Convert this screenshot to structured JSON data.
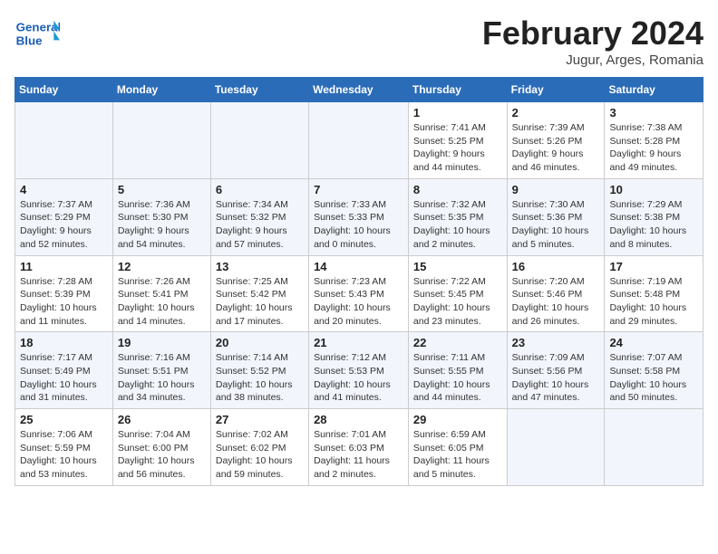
{
  "header": {
    "title": "February 2024",
    "subtitle": "Jugur, Arges, Romania",
    "logo_text_general": "General",
    "logo_text_blue": "Blue"
  },
  "days_of_week": [
    "Sunday",
    "Monday",
    "Tuesday",
    "Wednesday",
    "Thursday",
    "Friday",
    "Saturday"
  ],
  "weeks": [
    [
      {
        "day": "",
        "info": ""
      },
      {
        "day": "",
        "info": ""
      },
      {
        "day": "",
        "info": ""
      },
      {
        "day": "",
        "info": ""
      },
      {
        "day": "1",
        "info": "Sunrise: 7:41 AM\nSunset: 5:25 PM\nDaylight: 9 hours\nand 44 minutes."
      },
      {
        "day": "2",
        "info": "Sunrise: 7:39 AM\nSunset: 5:26 PM\nDaylight: 9 hours\nand 46 minutes."
      },
      {
        "day": "3",
        "info": "Sunrise: 7:38 AM\nSunset: 5:28 PM\nDaylight: 9 hours\nand 49 minutes."
      }
    ],
    [
      {
        "day": "4",
        "info": "Sunrise: 7:37 AM\nSunset: 5:29 PM\nDaylight: 9 hours\nand 52 minutes."
      },
      {
        "day": "5",
        "info": "Sunrise: 7:36 AM\nSunset: 5:30 PM\nDaylight: 9 hours\nand 54 minutes."
      },
      {
        "day": "6",
        "info": "Sunrise: 7:34 AM\nSunset: 5:32 PM\nDaylight: 9 hours\nand 57 minutes."
      },
      {
        "day": "7",
        "info": "Sunrise: 7:33 AM\nSunset: 5:33 PM\nDaylight: 10 hours\nand 0 minutes."
      },
      {
        "day": "8",
        "info": "Sunrise: 7:32 AM\nSunset: 5:35 PM\nDaylight: 10 hours\nand 2 minutes."
      },
      {
        "day": "9",
        "info": "Sunrise: 7:30 AM\nSunset: 5:36 PM\nDaylight: 10 hours\nand 5 minutes."
      },
      {
        "day": "10",
        "info": "Sunrise: 7:29 AM\nSunset: 5:38 PM\nDaylight: 10 hours\nand 8 minutes."
      }
    ],
    [
      {
        "day": "11",
        "info": "Sunrise: 7:28 AM\nSunset: 5:39 PM\nDaylight: 10 hours\nand 11 minutes."
      },
      {
        "day": "12",
        "info": "Sunrise: 7:26 AM\nSunset: 5:41 PM\nDaylight: 10 hours\nand 14 minutes."
      },
      {
        "day": "13",
        "info": "Sunrise: 7:25 AM\nSunset: 5:42 PM\nDaylight: 10 hours\nand 17 minutes."
      },
      {
        "day": "14",
        "info": "Sunrise: 7:23 AM\nSunset: 5:43 PM\nDaylight: 10 hours\nand 20 minutes."
      },
      {
        "day": "15",
        "info": "Sunrise: 7:22 AM\nSunset: 5:45 PM\nDaylight: 10 hours\nand 23 minutes."
      },
      {
        "day": "16",
        "info": "Sunrise: 7:20 AM\nSunset: 5:46 PM\nDaylight: 10 hours\nand 26 minutes."
      },
      {
        "day": "17",
        "info": "Sunrise: 7:19 AM\nSunset: 5:48 PM\nDaylight: 10 hours\nand 29 minutes."
      }
    ],
    [
      {
        "day": "18",
        "info": "Sunrise: 7:17 AM\nSunset: 5:49 PM\nDaylight: 10 hours\nand 31 minutes."
      },
      {
        "day": "19",
        "info": "Sunrise: 7:16 AM\nSunset: 5:51 PM\nDaylight: 10 hours\nand 34 minutes."
      },
      {
        "day": "20",
        "info": "Sunrise: 7:14 AM\nSunset: 5:52 PM\nDaylight: 10 hours\nand 38 minutes."
      },
      {
        "day": "21",
        "info": "Sunrise: 7:12 AM\nSunset: 5:53 PM\nDaylight: 10 hours\nand 41 minutes."
      },
      {
        "day": "22",
        "info": "Sunrise: 7:11 AM\nSunset: 5:55 PM\nDaylight: 10 hours\nand 44 minutes."
      },
      {
        "day": "23",
        "info": "Sunrise: 7:09 AM\nSunset: 5:56 PM\nDaylight: 10 hours\nand 47 minutes."
      },
      {
        "day": "24",
        "info": "Sunrise: 7:07 AM\nSunset: 5:58 PM\nDaylight: 10 hours\nand 50 minutes."
      }
    ],
    [
      {
        "day": "25",
        "info": "Sunrise: 7:06 AM\nSunset: 5:59 PM\nDaylight: 10 hours\nand 53 minutes."
      },
      {
        "day": "26",
        "info": "Sunrise: 7:04 AM\nSunset: 6:00 PM\nDaylight: 10 hours\nand 56 minutes."
      },
      {
        "day": "27",
        "info": "Sunrise: 7:02 AM\nSunset: 6:02 PM\nDaylight: 10 hours\nand 59 minutes."
      },
      {
        "day": "28",
        "info": "Sunrise: 7:01 AM\nSunset: 6:03 PM\nDaylight: 11 hours\nand 2 minutes."
      },
      {
        "day": "29",
        "info": "Sunrise: 6:59 AM\nSunset: 6:05 PM\nDaylight: 11 hours\nand 5 minutes."
      },
      {
        "day": "",
        "info": ""
      },
      {
        "day": "",
        "info": ""
      }
    ]
  ]
}
